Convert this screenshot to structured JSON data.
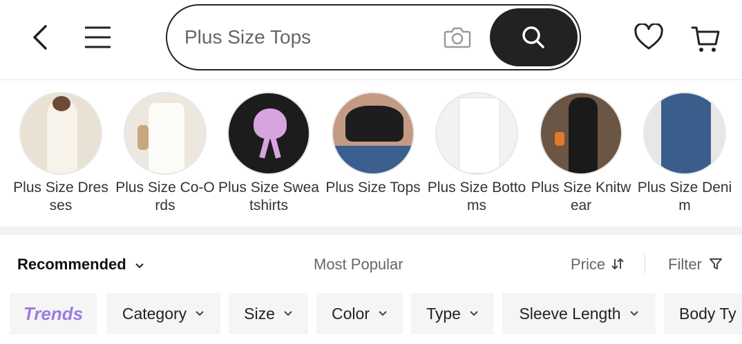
{
  "header": {
    "back_icon": "chevron-left-icon",
    "menu_icon": "hamburger-menu-icon",
    "search": {
      "value": "Plus Size Tops"
    },
    "camera_icon": "camera-icon",
    "search_icon": "search-icon",
    "wishlist_icon": "heart-icon",
    "cart_icon": "cart-icon"
  },
  "categories": [
    {
      "label": "Plus Size Dresses",
      "bg": "#e9e2d4"
    },
    {
      "label": "Plus Size Co-Ords",
      "bg": "#ece7df"
    },
    {
      "label": "Plus Size Sweatshirts",
      "bg": "#1c1c1c"
    },
    {
      "label": "Plus Size Tops",
      "bg": "#c49a82"
    },
    {
      "label": "Plus Size Bottoms",
      "bg": "#f2f2f2"
    },
    {
      "label": "Plus Size Knitwear",
      "bg": "#6b5544"
    },
    {
      "label": "Plus Size Denim",
      "bg": "#3a5d8c"
    }
  ],
  "sort": {
    "recommended": "Recommended",
    "most_popular": "Most Popular",
    "price": "Price",
    "filter": "Filter"
  },
  "chips": {
    "trends": "Trends",
    "items": [
      "Category",
      "Size",
      "Color",
      "Type",
      "Sleeve Length",
      "Body Ty"
    ]
  },
  "colors": {
    "accent_dark": "#222222",
    "trends_purple": "#9a7de0"
  }
}
